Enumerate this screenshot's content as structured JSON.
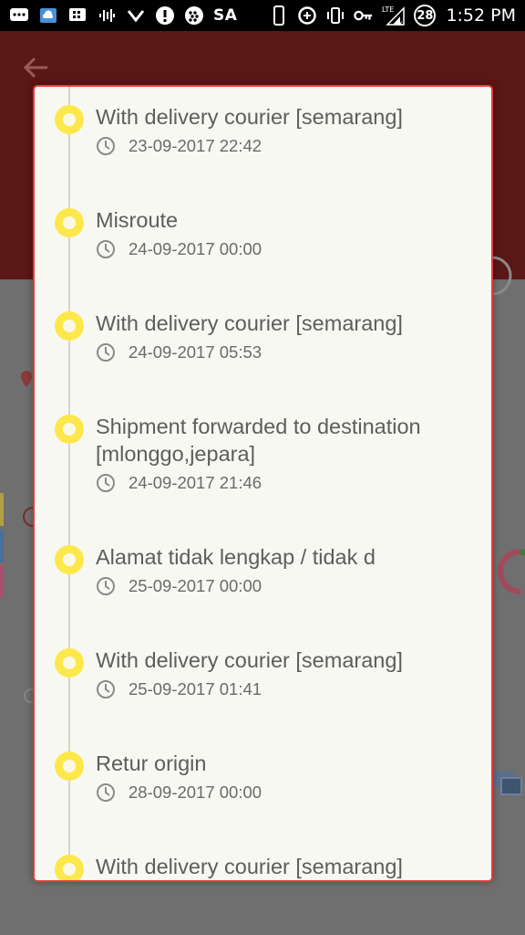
{
  "status_bar": {
    "carrier": "SA",
    "badge": "28",
    "network": "LTE",
    "time": "1:52 PM"
  },
  "colors": {
    "accent": "#e63a3a",
    "timeline_dot": "#fde84c",
    "header_bg": "#5b1616"
  },
  "icons": {
    "back": "arrow-left-icon",
    "time": "clock-icon"
  },
  "tracking": [
    {
      "status": "With delivery courier [semarang]",
      "time": "23-09-2017 22:42"
    },
    {
      "status": "Misroute",
      "time": "24-09-2017 00:00"
    },
    {
      "status": "With delivery courier [semarang]",
      "time": "24-09-2017 05:53"
    },
    {
      "status": "Shipment forwarded to destination [mlonggo,jepara]",
      "time": "24-09-2017 21:46"
    },
    {
      "status": "Alamat tidak lengkap / tidak d",
      "time": "25-09-2017 00:00"
    },
    {
      "status": "With delivery courier [semarang]",
      "time": "25-09-2017 01:41"
    },
    {
      "status": "Retur origin",
      "time": "28-09-2017 00:00"
    },
    {
      "status": "With delivery courier [semarang]",
      "time": ""
    }
  ]
}
